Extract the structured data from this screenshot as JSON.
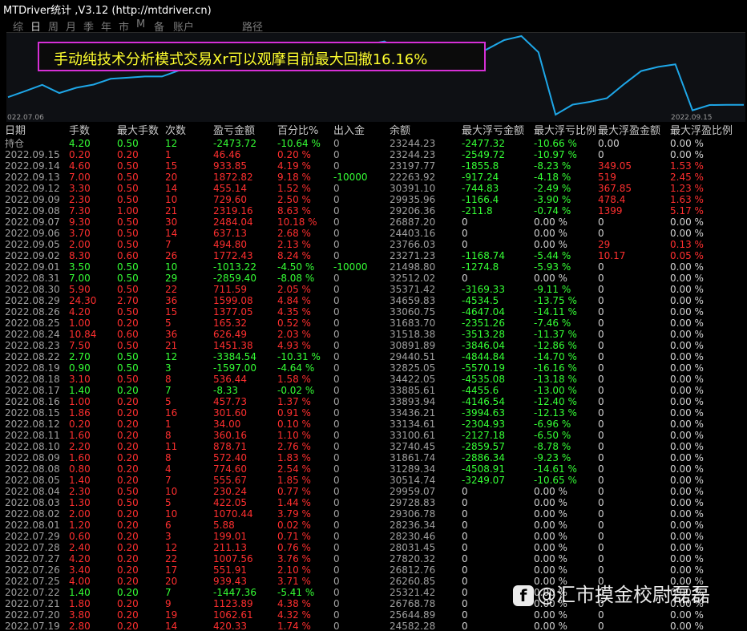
{
  "window": {
    "title": "MTDriver统计 ,V3.12 (http://mtdriver.cn)"
  },
  "tabs": [
    "综",
    "日",
    "周",
    "月",
    "季",
    "年",
    "市",
    "M",
    "备",
    "账户",
    "路径"
  ],
  "active_tab": 1,
  "annotation": "手动纯技术分析模式交易Xr可以观摩目前最大回撤16.16%",
  "chart": {
    "x_start": "022.07.06",
    "x_end": "2022.09.15",
    "line_color": "#1ea7e8",
    "balance_series": [
      24582.28,
      25644.89,
      26768.78,
      25321.42,
      26260.85,
      26812.76,
      27820.32,
      28031.45,
      28230.46,
      28236.34,
      29306.78,
      29728.83,
      29959.07,
      30514.74,
      31289.34,
      31861.74,
      32740.45,
      33100.61,
      33134.61,
      33436.21,
      33893.94,
      33885.61,
      34422.05,
      32825.05,
      29440.51,
      30891.89,
      31518.38,
      31683.7,
      33060.75,
      34659.83,
      35371.42,
      32512.02,
      21498.8,
      23271.23,
      23766.03,
      24403.16,
      26887.2,
      29206.36,
      29935.96,
      30391.1,
      22263.92,
      23197.77,
      23244.23,
      23244.23
    ]
  },
  "columns": [
    "日期",
    "手数",
    "最大手数",
    "次数",
    "盈亏金额",
    "百分比%",
    "出入金",
    "余额",
    "最大浮亏金额",
    "最大浮亏比例",
    "最大浮盈金额",
    "最大浮盈比例"
  ],
  "rows": [
    [
      "持仓",
      "4.20",
      "0.50",
      "12",
      "-2473.72",
      "-10.64 %",
      "0",
      "23244.23",
      "-2477.32",
      "-10.66 %",
      "0.00",
      "0.00 %"
    ],
    [
      "2022.09.15",
      "0.20",
      "0.20",
      "1",
      "46.46",
      "0.20 %",
      "0",
      "23244.23",
      "-2549.72",
      "-10.97 %",
      "0",
      "0.00 %"
    ],
    [
      "2022.09.14",
      "4.60",
      "0.50",
      "15",
      "933.85",
      "4.19 %",
      "0",
      "23197.77",
      "-1855.8",
      "-8.23 %",
      "349.05",
      "1.53 %"
    ],
    [
      "2022.09.13",
      "7.00",
      "0.50",
      "20",
      "1872.82",
      "9.18 %",
      "-10000",
      "22263.92",
      "-917.24",
      "-4.18 %",
      "519",
      "2.45 %"
    ],
    [
      "2022.09.12",
      "3.30",
      "0.50",
      "14",
      "455.14",
      "1.52 %",
      "0",
      "30391.10",
      "-744.83",
      "-2.49 %",
      "367.85",
      "1.23 %"
    ],
    [
      "2022.09.09",
      "2.30",
      "0.50",
      "10",
      "729.60",
      "2.50 %",
      "0",
      "29935.96",
      "-1166.4",
      "-3.90 %",
      "478.4",
      "1.63 %"
    ],
    [
      "2022.09.08",
      "7.30",
      "1.00",
      "21",
      "2319.16",
      "8.63 %",
      "0",
      "29206.36",
      "-211.8",
      "-0.74 %",
      "1399",
      "5.17 %"
    ],
    [
      "2022.09.07",
      "9.30",
      "0.50",
      "30",
      "2484.04",
      "10.18 %",
      "0",
      "26887.20",
      "0",
      "0.00 %",
      "0",
      "0.00 %"
    ],
    [
      "2022.09.06",
      "3.70",
      "0.50",
      "14",
      "637.13",
      "2.68 %",
      "0",
      "24403.16",
      "0",
      "0.00 %",
      "0",
      "0.00 %"
    ],
    [
      "2022.09.05",
      "2.00",
      "0.50",
      "7",
      "494.80",
      "2.13 %",
      "0",
      "23766.03",
      "0",
      "0.00 %",
      "29",
      "0.13 %"
    ],
    [
      "2022.09.02",
      "8.30",
      "0.60",
      "26",
      "1772.43",
      "8.24 %",
      "0",
      "23271.23",
      "-1168.74",
      "-5.44 %",
      "10.17",
      "0.05 %"
    ],
    [
      "2022.09.01",
      "3.50",
      "0.50",
      "10",
      "-1013.22",
      "-4.50 %",
      "-10000",
      "21498.80",
      "-1274.8",
      "-5.93 %",
      "0",
      "0.00 %"
    ],
    [
      "2022.08.31",
      "7.00",
      "0.50",
      "29",
      "-2859.40",
      "-8.08 %",
      "0",
      "32512.02",
      "0",
      "0.00 %",
      "0",
      "0.00 %"
    ],
    [
      "2022.08.30",
      "5.90",
      "0.50",
      "22",
      "711.59",
      "2.05 %",
      "0",
      "35371.42",
      "-3169.33",
      "-9.11 %",
      "0",
      "0.00 %"
    ],
    [
      "2022.08.29",
      "24.30",
      "2.70",
      "36",
      "1599.08",
      "4.84 %",
      "0",
      "34659.83",
      "-4534.5",
      "-13.75 %",
      "0",
      "0.00 %"
    ],
    [
      "2022.08.26",
      "4.20",
      "0.50",
      "15",
      "1377.05",
      "4.35 %",
      "0",
      "33060.75",
      "-4647.04",
      "-14.11 %",
      "0",
      "0.00 %"
    ],
    [
      "2022.08.25",
      "1.00",
      "0.20",
      "5",
      "165.32",
      "0.52 %",
      "0",
      "31683.70",
      "-2351.26",
      "-7.46 %",
      "0",
      "0.00 %"
    ],
    [
      "2022.08.24",
      "10.84",
      "0.60",
      "36",
      "626.49",
      "2.03 %",
      "0",
      "31518.38",
      "-3513.28",
      "-11.37 %",
      "0",
      "0.00 %"
    ],
    [
      "2022.08.23",
      "7.50",
      "0.50",
      "21",
      "1451.38",
      "4.93 %",
      "0",
      "30891.89",
      "-3846.04",
      "-12.86 %",
      "0",
      "0.00 %"
    ],
    [
      "2022.08.22",
      "2.70",
      "0.50",
      "12",
      "-3384.54",
      "-10.31 %",
      "0",
      "29440.51",
      "-4844.84",
      "-14.70 %",
      "0",
      "0.00 %"
    ],
    [
      "2022.08.19",
      "0.90",
      "0.50",
      "3",
      "-1597.00",
      "-4.64 %",
      "0",
      "32825.05",
      "-5570.19",
      "-16.16 %",
      "0",
      "0.00 %"
    ],
    [
      "2022.08.18",
      "3.10",
      "0.50",
      "8",
      "536.44",
      "1.58 %",
      "0",
      "34422.05",
      "-4535.08",
      "-13.18 %",
      "0",
      "0.00 %"
    ],
    [
      "2022.08.17",
      "1.40",
      "0.20",
      "7",
      "-8.33",
      "-0.02 %",
      "0",
      "33885.61",
      "-4455.6",
      "-13.00 %",
      "0",
      "0.00 %"
    ],
    [
      "2022.08.16",
      "1.00",
      "0.20",
      "5",
      "457.73",
      "1.37 %",
      "0",
      "33893.94",
      "-4146.54",
      "-12.40 %",
      "0",
      "0.00 %"
    ],
    [
      "2022.08.15",
      "1.86",
      "0.20",
      "16",
      "301.60",
      "0.91 %",
      "0",
      "33436.21",
      "-3994.63",
      "-12.13 %",
      "0",
      "0.00 %"
    ],
    [
      "2022.08.12",
      "0.20",
      "0.20",
      "1",
      "34.00",
      "0.10 %",
      "0",
      "33134.61",
      "-2304.93",
      "-6.96 %",
      "0",
      "0.00 %"
    ],
    [
      "2022.08.11",
      "1.60",
      "0.20",
      "8",
      "360.16",
      "1.10 %",
      "0",
      "33100.61",
      "-2127.18",
      "-6.50 %",
      "0",
      "0.00 %"
    ],
    [
      "2022.08.10",
      "2.20",
      "0.20",
      "11",
      "878.71",
      "2.76 %",
      "0",
      "32740.45",
      "-2859.57",
      "-8.78 %",
      "0",
      "0.00 %"
    ],
    [
      "2022.08.09",
      "1.60",
      "0.20",
      "8",
      "572.40",
      "1.83 %",
      "0",
      "31861.74",
      "-2886.34",
      "-9.23 %",
      "0",
      "0.00 %"
    ],
    [
      "2022.08.08",
      "0.80",
      "0.20",
      "4",
      "774.60",
      "2.54 %",
      "0",
      "31289.34",
      "-4508.91",
      "-14.61 %",
      "0",
      "0.00 %"
    ],
    [
      "2022.08.05",
      "1.40",
      "0.20",
      "7",
      "555.67",
      "1.85 %",
      "0",
      "30514.74",
      "-3249.07",
      "-10.65 %",
      "0",
      "0.00 %"
    ],
    [
      "2022.08.04",
      "2.30",
      "0.50",
      "10",
      "230.24",
      "0.77 %",
      "0",
      "29959.07",
      "0",
      "0.00 %",
      "0",
      "0.00 %"
    ],
    [
      "2022.08.03",
      "1.30",
      "0.50",
      "5",
      "422.05",
      "1.44 %",
      "0",
      "29728.83",
      "0",
      "0.00 %",
      "0",
      "0.00 %"
    ],
    [
      "2022.08.02",
      "2.00",
      "0.20",
      "10",
      "1070.44",
      "3.79 %",
      "0",
      "29306.78",
      "0",
      "0.00 %",
      "0",
      "0.00 %"
    ],
    [
      "2022.08.01",
      "1.20",
      "0.20",
      "6",
      "5.88",
      "0.02 %",
      "0",
      "28236.34",
      "0",
      "0.00 %",
      "0",
      "0.00 %"
    ],
    [
      "2022.07.29",
      "0.60",
      "0.20",
      "3",
      "199.01",
      "0.71 %",
      "0",
      "28230.46",
      "0",
      "0.00 %",
      "0",
      "0.00 %"
    ],
    [
      "2022.07.28",
      "2.40",
      "0.20",
      "12",
      "211.13",
      "0.76 %",
      "0",
      "28031.45",
      "0",
      "0.00 %",
      "0",
      "0.00 %"
    ],
    [
      "2022.07.27",
      "4.20",
      "0.20",
      "22",
      "1007.56",
      "3.76 %",
      "0",
      "27820.32",
      "0",
      "0.00 %",
      "0",
      "0.00 %"
    ],
    [
      "2022.07.26",
      "3.40",
      "0.20",
      "17",
      "551.91",
      "2.10 %",
      "0",
      "26812.76",
      "0",
      "0.00 %",
      "0",
      "0.00 %"
    ],
    [
      "2022.07.25",
      "4.00",
      "0.20",
      "20",
      "939.43",
      "3.71 %",
      "0",
      "26260.85",
      "0",
      "0.00 %",
      "0",
      "0.00 %"
    ],
    [
      "2022.07.22",
      "1.40",
      "0.20",
      "7",
      "-1447.36",
      "-5.41 %",
      "0",
      "25321.42",
      "0",
      "0.00 %",
      "0",
      "0.00 %"
    ],
    [
      "2022.07.21",
      "1.80",
      "0.20",
      "9",
      "1123.89",
      "4.38 %",
      "0",
      "26768.78",
      "0",
      "0.00 %",
      "0",
      "0.00 %"
    ],
    [
      "2022.07.20",
      "3.80",
      "0.20",
      "19",
      "1062.61",
      "4.32 %",
      "0",
      "25644.89",
      "0",
      "0.00 %",
      "0",
      "0.00 %"
    ],
    [
      "2022.07.19",
      "2.80",
      "0.20",
      "14",
      "420.33",
      "1.74 %",
      "0",
      "24582.28",
      "0",
      "0.00 %",
      "0",
      "0.00 %"
    ]
  ],
  "watermark": {
    "text": "@汇市摸金校尉磊磊",
    "logo": "f"
  }
}
